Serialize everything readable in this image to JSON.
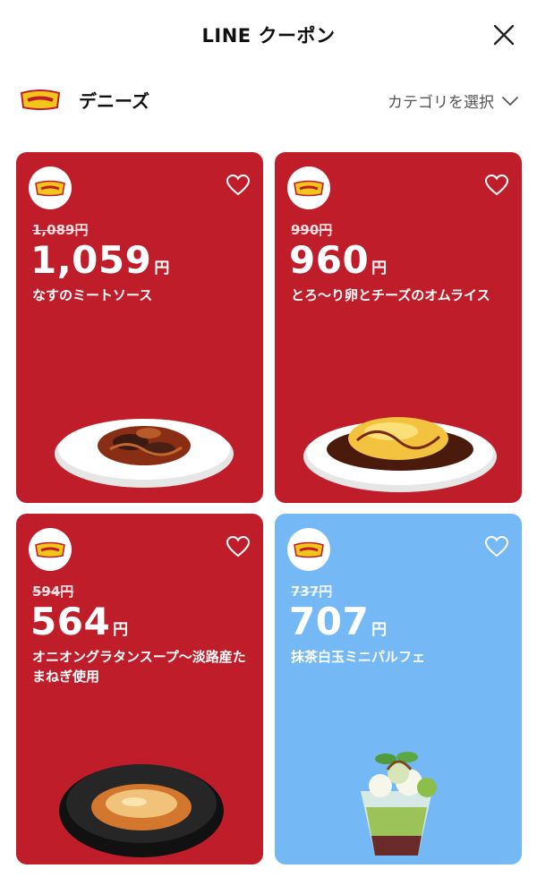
{
  "header": {
    "title": "LINE クーポン"
  },
  "brand": {
    "name": "デニーズ",
    "category_label": "カテゴリを選択"
  },
  "coupons": [
    {
      "old_price": "1,089円",
      "price": "1,059",
      "yen": "円",
      "name": "なすのミートソース",
      "bg": "#c01d2a"
    },
    {
      "old_price": "990円",
      "price": "960",
      "yen": "円",
      "name": "とろ〜り卵とチーズのオムライス",
      "bg": "#c01d2a"
    },
    {
      "old_price": "594円",
      "price": "564",
      "yen": "円",
      "name": "オニオングラタンスープ〜淡路産たまねぎ使用",
      "bg": "#c01d2a"
    },
    {
      "old_price": "737円",
      "price": "707",
      "yen": "円",
      "name": "抹茶白玉ミニパルフェ",
      "bg": "#75b8f6"
    }
  ],
  "colors": {
    "brand_red": "#c01d2a",
    "dessert_blue": "#75b8f6",
    "logo_yellow": "#f2c51b"
  }
}
